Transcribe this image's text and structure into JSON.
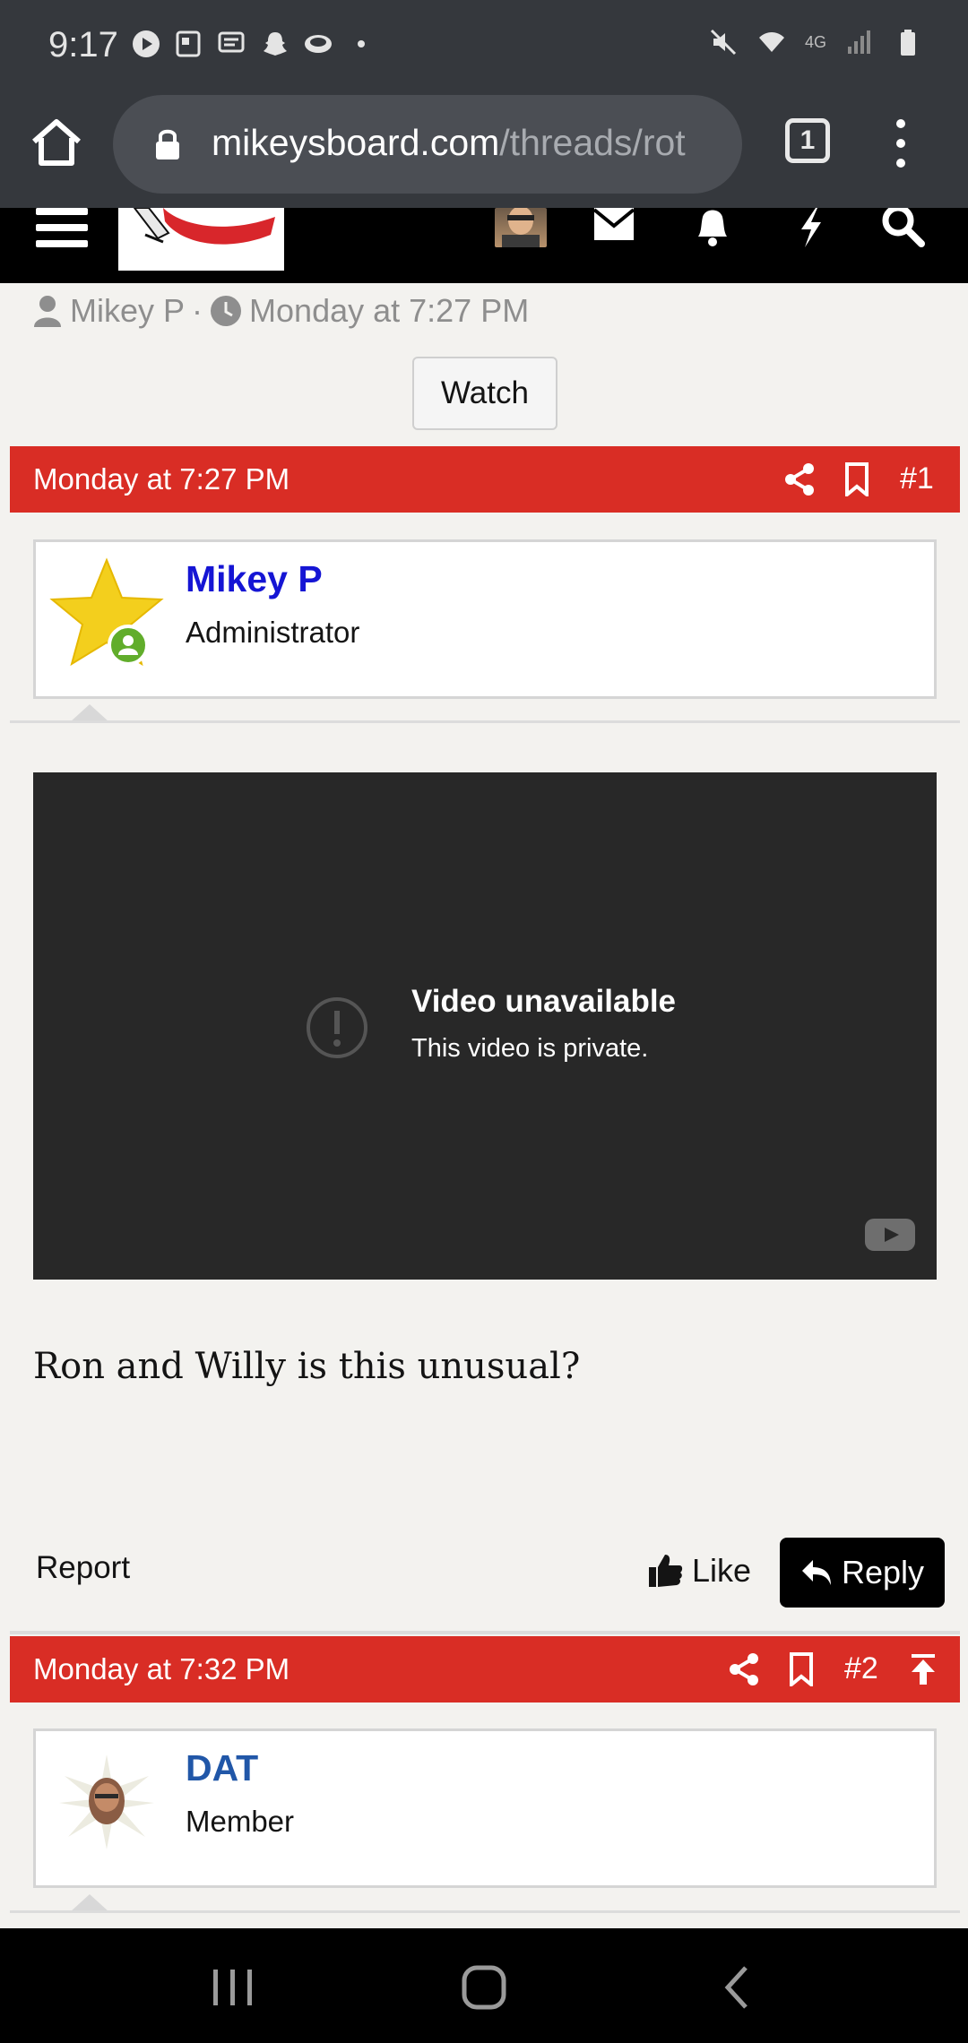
{
  "status_bar": {
    "time": "9:17",
    "network": "4G"
  },
  "browser": {
    "url_host": "mikeysboard.com",
    "url_path": "/threads/rot",
    "tab_count": "1"
  },
  "thread_meta": {
    "author": "Mikey P",
    "separator": "·",
    "date": "Monday at 7:27 PM",
    "watch_label": "Watch"
  },
  "posts": [
    {
      "date": "Monday at 7:27 PM",
      "number": "#1",
      "user_name": "Mikey P",
      "user_role": "Administrator",
      "user_name_color": "#1515d4",
      "video_title": "Video unavailable",
      "video_subtitle": "This video is private.",
      "body": "Ron and Willy is this unusual?",
      "report_label": "Report",
      "like_label": "Like",
      "reply_label": "Reply"
    },
    {
      "date": "Monday at 7:32 PM",
      "number": "#2",
      "user_name": "DAT",
      "user_role": "Member",
      "user_name_color": "#2157a8"
    }
  ],
  "colors": {
    "post_bar": "#d92d25",
    "online": "#61ad2b"
  }
}
